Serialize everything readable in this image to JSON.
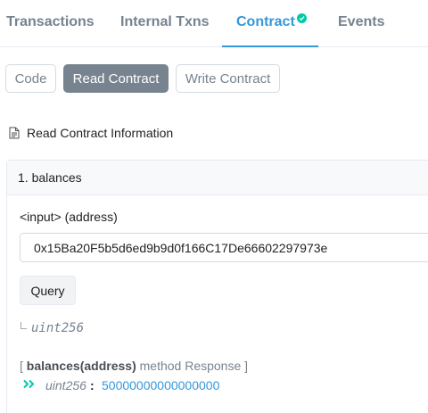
{
  "tabs": [
    {
      "label": "Transactions"
    },
    {
      "label": "Internal Txns"
    },
    {
      "label": "Contract",
      "active": true
    },
    {
      "label": "Events"
    }
  ],
  "subnav": {
    "code_label": "Code",
    "read_label": "Read Contract",
    "write_label": "Write Contract",
    "active": "Read Contract"
  },
  "section": {
    "heading": "Read Contract Information"
  },
  "method": {
    "title": "1. balances",
    "input_label": "<input> (address)",
    "input_value": "0x15Ba20F5b5d6ed9b9d0f166C17De66602297973e",
    "query_label": "Query",
    "return_type": "uint256",
    "response_prefix": "[ ",
    "response_method": "balances(address)",
    "response_suffix": " method Response ]",
    "result_type": "uint256",
    "result_colon": ":",
    "result_value": "50000000000000000"
  },
  "colors": {
    "accent": "#3498db",
    "verified": "#00c9a7",
    "muted": "#77838f"
  },
  "icons": {
    "verified": "check-circle-icon",
    "heading": "document-icon",
    "return": "return-corner-icon",
    "result": "double-chevron-right-icon"
  }
}
